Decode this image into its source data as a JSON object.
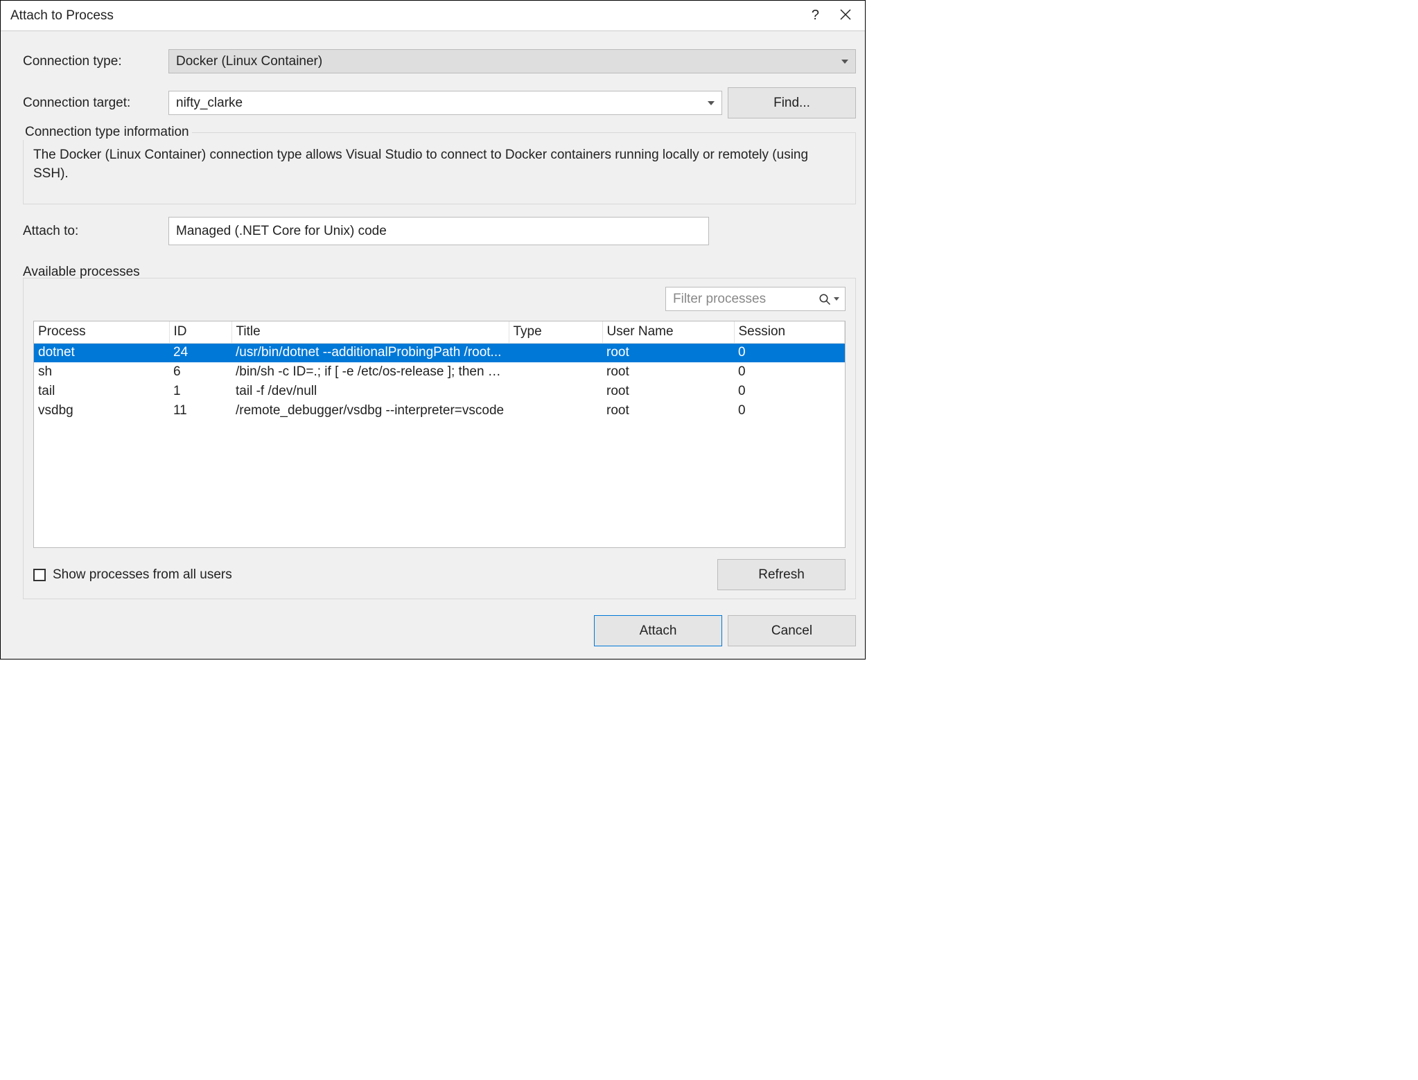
{
  "dialog": {
    "title": "Attach to Process",
    "help_icon": "?"
  },
  "connection": {
    "type_label": "Connection type:",
    "type_value": "Docker (Linux Container)",
    "target_label": "Connection target:",
    "target_value": "nifty_clarke",
    "find_button": "Find...",
    "info_heading": "Connection type information",
    "info_text": "The Docker (Linux Container) connection type allows Visual Studio to connect to Docker containers running locally or remotely (using SSH)."
  },
  "attach_to": {
    "label": "Attach to:",
    "value": "Managed (.NET Core for Unix) code"
  },
  "processes": {
    "heading": "Available processes",
    "filter_placeholder": "Filter processes",
    "columns": {
      "process": "Process",
      "id": "ID",
      "title": "Title",
      "type": "Type",
      "user": "User Name",
      "session": "Session"
    },
    "rows": [
      {
        "process": "dotnet",
        "id": "24",
        "title": "/usr/bin/dotnet --additionalProbingPath /root...",
        "type": "",
        "user": "root",
        "session": "0",
        "selected": true
      },
      {
        "process": "sh",
        "id": "6",
        "title": "/bin/sh -c ID=.; if [ -e /etc/os-release ]; then . /...",
        "type": "",
        "user": "root",
        "session": "0",
        "selected": false
      },
      {
        "process": "tail",
        "id": "1",
        "title": "tail -f /dev/null",
        "type": "",
        "user": "root",
        "session": "0",
        "selected": false
      },
      {
        "process": "vsdbg",
        "id": "11",
        "title": "/remote_debugger/vsdbg --interpreter=vscode",
        "type": "",
        "user": "root",
        "session": "0",
        "selected": false
      }
    ],
    "show_all_label": "Show processes from all users",
    "refresh_button": "Refresh"
  },
  "buttons": {
    "attach": "Attach",
    "cancel": "Cancel"
  }
}
